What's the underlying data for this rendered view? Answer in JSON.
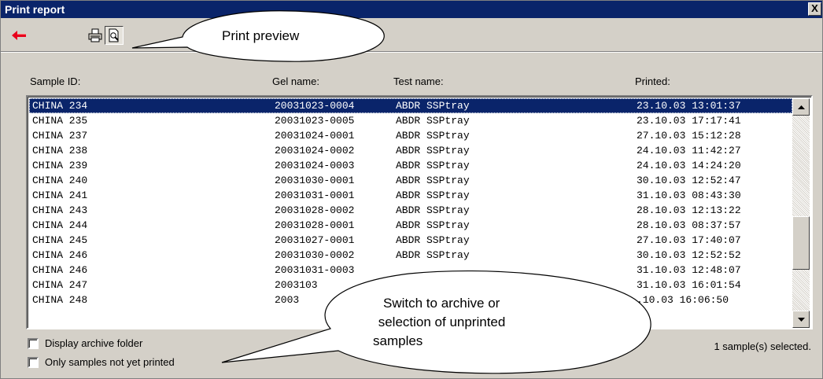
{
  "window": {
    "title": "Print report",
    "close_label": "X"
  },
  "toolbar": {
    "back_icon": "red-arrow-left-icon",
    "print_icon": "printer-icon",
    "preview_icon": "print-preview-icon"
  },
  "columns": [
    "Sample ID:",
    "Gel name:",
    "Test name:",
    "Printed:"
  ],
  "rows": [
    {
      "id": "CHINA 234",
      "gel": "20031023-0004",
      "test": "ABDR SSPtray",
      "printed": "23.10.03 13:01:37",
      "selected": true
    },
    {
      "id": "CHINA 235",
      "gel": "20031023-0005",
      "test": "ABDR SSPtray",
      "printed": "23.10.03 17:17:41"
    },
    {
      "id": "CHINA 237",
      "gel": "20031024-0001",
      "test": "ABDR SSPtray",
      "printed": "27.10.03 15:12:28"
    },
    {
      "id": "CHINA 238",
      "gel": "20031024-0002",
      "test": "ABDR SSPtray",
      "printed": "24.10.03 11:42:27"
    },
    {
      "id": "CHINA 239",
      "gel": "20031024-0003",
      "test": "ABDR SSPtray",
      "printed": "24.10.03 14:24:20"
    },
    {
      "id": "CHINA 240",
      "gel": "20031030-0001",
      "test": "ABDR SSPtray",
      "printed": "30.10.03 12:52:47"
    },
    {
      "id": "CHINA 241",
      "gel": "20031031-0001",
      "test": "ABDR SSPtray",
      "printed": "31.10.03 08:43:30"
    },
    {
      "id": "CHINA 243",
      "gel": "20031028-0002",
      "test": "ABDR SSPtray",
      "printed": "28.10.03 12:13:22"
    },
    {
      "id": "CHINA 244",
      "gel": "20031028-0001",
      "test": "ABDR SSPtray",
      "printed": "28.10.03 08:37:57"
    },
    {
      "id": "CHINA 245",
      "gel": "20031027-0001",
      "test": "ABDR SSPtray",
      "printed": "27.10.03 17:40:07"
    },
    {
      "id": "CHINA 246",
      "gel": "20031030-0002",
      "test": "ABDR SSPtray",
      "printed": "30.10.03 12:52:52"
    },
    {
      "id": "CHINA 246",
      "gel": "20031031-0003",
      "test": "",
      "printed": "31.10.03 12:48:07"
    },
    {
      "id": "CHINA 247",
      "gel": "2003103",
      "test": "",
      "printed": "31.10.03 16:01:54"
    },
    {
      "id": "CHINA 248",
      "gel": "2003",
      "test": "",
      "printed": ".10.03 16:06:50"
    }
  ],
  "options": {
    "archive_label": "Display archive folder",
    "unprinted_label": "Only samples not yet printed"
  },
  "status": {
    "text": "1 sample(s) selected."
  },
  "callouts": {
    "preview": "Print preview",
    "switch_line1": "Switch to archive or",
    "switch_line2": " selection of unprinted",
    "switch_line3": "samples"
  },
  "colors": {
    "titlebar": "#0a246a",
    "selection": "#0a246a",
    "face": "#d4d0c8",
    "arrow": "#e8001c"
  }
}
